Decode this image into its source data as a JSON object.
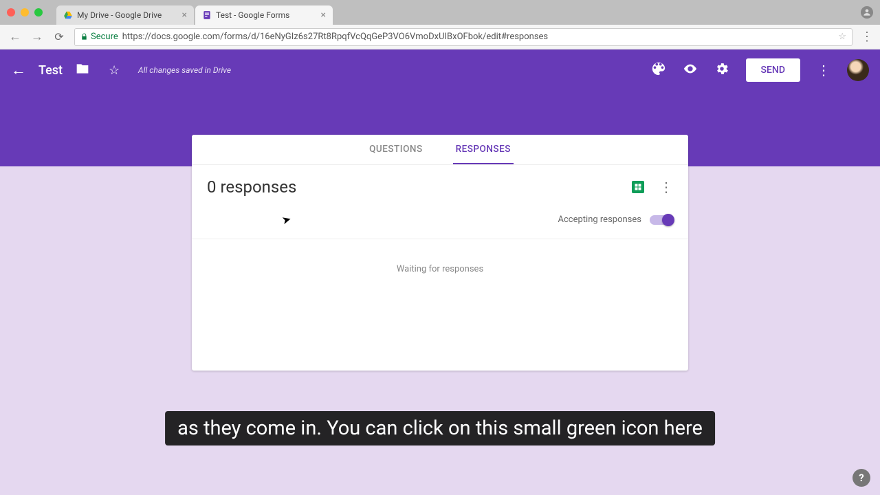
{
  "browser": {
    "tabs": [
      {
        "title": "My Drive - Google Drive"
      },
      {
        "title": "Test - Google Forms"
      }
    ],
    "secure_label": "Secure",
    "url": "https://docs.google.com/forms/d/16eNyGIz6s27Rt8RpqfVcQqGeP3VO6VmoDxUIBxOFbok/edit#responses"
  },
  "header": {
    "title": "Test",
    "saved": "All changes saved in Drive",
    "send": "SEND"
  },
  "tabs": {
    "questions": "QUESTIONS",
    "responses": "RESPONSES"
  },
  "responses": {
    "count_label": "0 responses",
    "accepting_label": "Accepting responses",
    "waiting": "Waiting for responses"
  },
  "caption": "as they come in. You can click on this small green icon here",
  "help": "?"
}
